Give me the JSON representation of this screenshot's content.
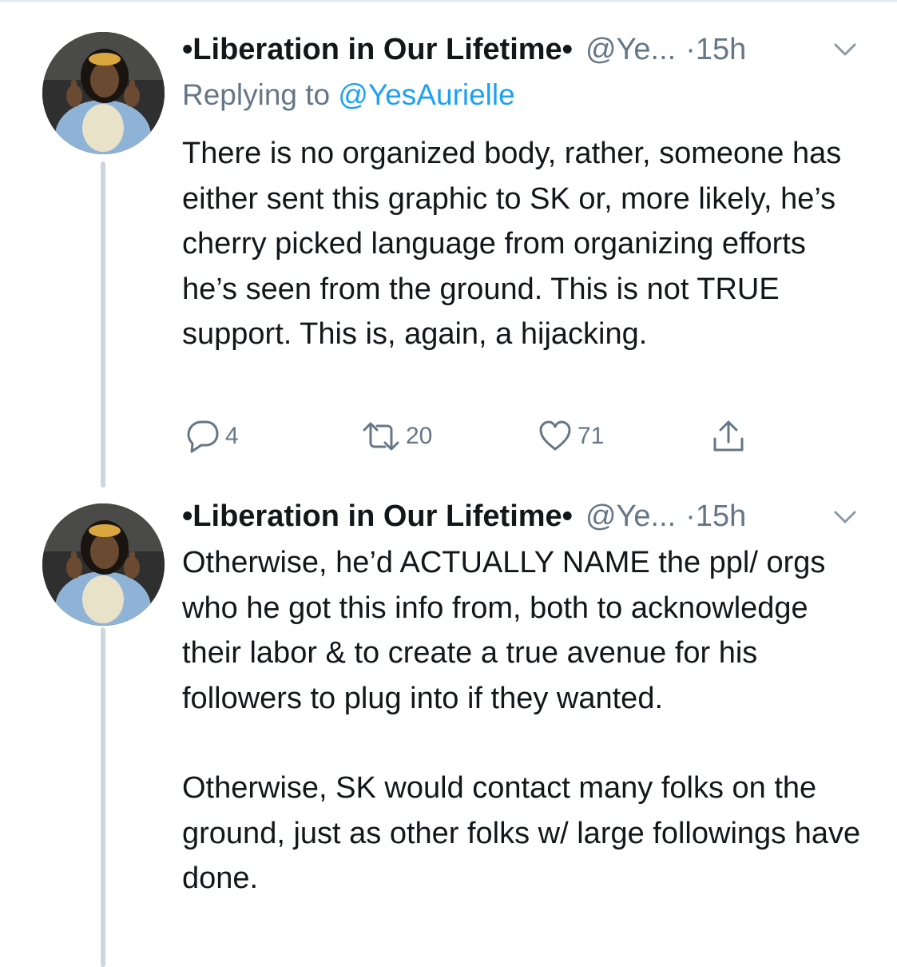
{
  "tweets": [
    {
      "display_name": "•Liberation in Our Lifetime•",
      "handle": "@Ye...",
      "time": "·15h",
      "reply_prefix": "Replying to ",
      "reply_handle": "@YesAurielle",
      "paragraphs": [
        "There is no organized body, rather, someone has either sent this graphic to SK or, more likely, he’s cherry picked language from organizing efforts he’s seen from the ground. This is not TRUE support. This is, again, a hijacking."
      ],
      "actions": {
        "reply_count": "4",
        "retweet_count": "20",
        "like_count": "71"
      }
    },
    {
      "display_name": "•Liberation in Our Lifetime•",
      "handle": "@Ye...",
      "time": "·15h",
      "paragraphs": [
        "Otherwise, he’d ACTUALLY NAME the ppl/ orgs who he got this info from, both to acknowledge their labor & to create a true avenue for his followers to plug into if they wanted.",
        "Otherwise, SK would contact many folks on the ground, just as other folks w/ large followings have done."
      ]
    }
  ],
  "icons": {
    "reply": "reply-icon",
    "retweet": "retweet-icon",
    "like": "heart-icon",
    "share": "share-icon",
    "caret": "chevron-down-icon"
  },
  "colors": {
    "text": "#14171a",
    "secondary": "#657786",
    "link": "#1da1f2",
    "thread_line": "#ccd6dd"
  }
}
